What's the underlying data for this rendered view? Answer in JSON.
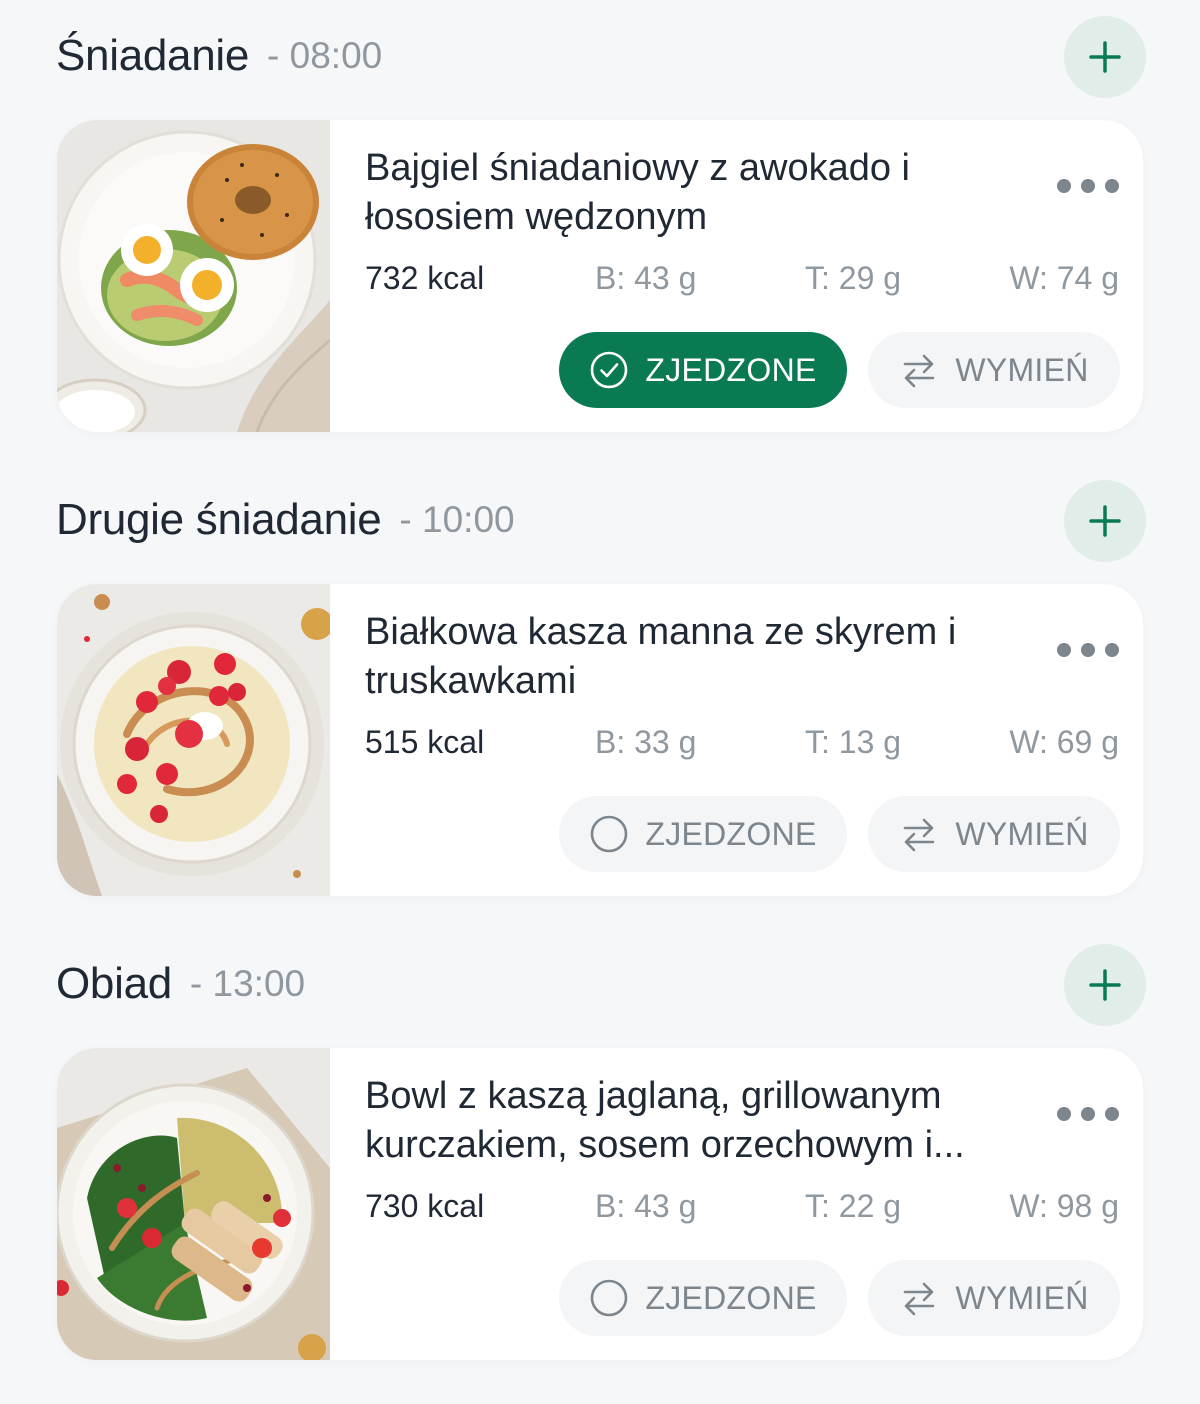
{
  "meals": [
    {
      "name": "Śniadanie",
      "time": "- 08:00",
      "title": "Bajgiel śniadaniowy z awokado i łososiem wędzonym",
      "kcal": "732 kcal",
      "protein": "B: 43 g",
      "fat": "T: 29 g",
      "carbs": "W: 74 g",
      "eaten_label": "ZJEDZONE",
      "eaten": true,
      "swap_label": "WYMIEŃ",
      "image": "bagel-avocado-salmon-photo"
    },
    {
      "name": "Drugie śniadanie",
      "time": "- 10:00",
      "title": "Białkowa kasza manna ze skyrem i truskawkami",
      "kcal": "515 kcal",
      "protein": "B: 33 g",
      "fat": "T: 13 g",
      "carbs": "W: 69 g",
      "eaten_label": "ZJEDZONE",
      "eaten": false,
      "swap_label": "WYMIEŃ",
      "image": "semolina-skyr-strawberries-photo"
    },
    {
      "name": "Obiad",
      "time": "- 13:00",
      "title": "Bowl z kaszą jaglaną, grillowanym kurczakiem, sosem orzechowym i...",
      "kcal": "730 kcal",
      "protein": "B: 43 g",
      "fat": "T: 22 g",
      "carbs": "W: 98 g",
      "eaten_label": "ZJEDZONE",
      "eaten": false,
      "swap_label": "WYMIEŃ",
      "image": "millet-chicken-bowl-photo"
    }
  ],
  "icons": {
    "add": "plus-icon",
    "more": "more-dots-icon",
    "eaten_done": "check-circle-icon",
    "eaten_todo": "empty-circle-icon",
    "swap": "swap-arrows-icon"
  },
  "colors": {
    "accent": "#0a7a52",
    "add_button_bg": "#e1ede8",
    "muted_text": "#8f979f",
    "page_bg": "#f6f7f9"
  }
}
